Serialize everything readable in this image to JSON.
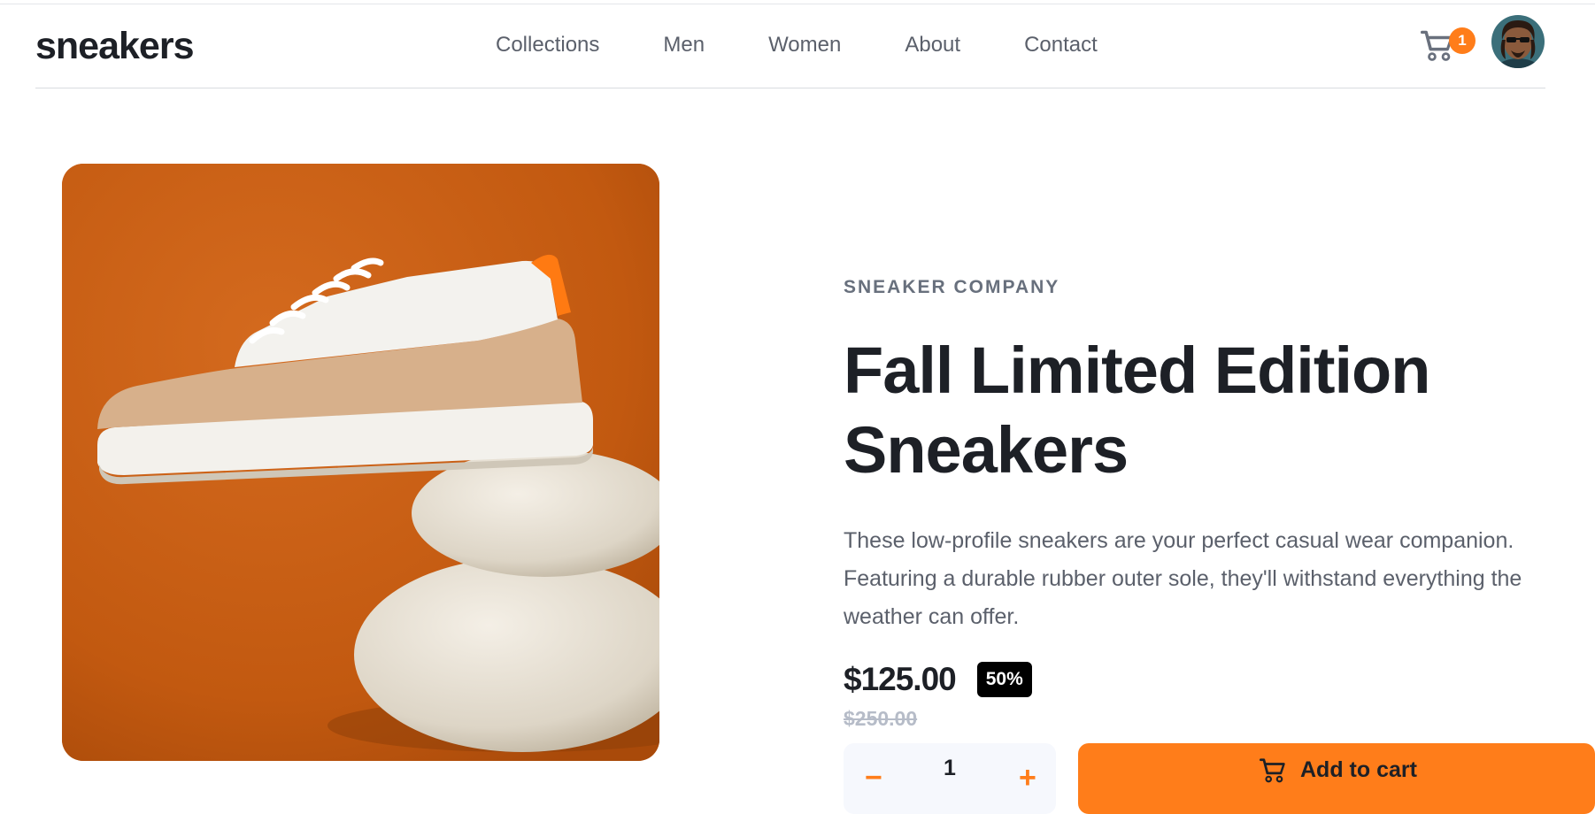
{
  "header": {
    "logo": "sneakers",
    "nav": [
      "Collections",
      "Men",
      "Women",
      "About",
      "Contact"
    ],
    "cart_count": "1"
  },
  "product": {
    "company": "SNEAKER COMPANY",
    "title": "Fall Limited Edition Sneakers",
    "description": "These low-profile sneakers are your perfect casual wear companion. Featuring a durable rubber outer sole, they'll withstand everything the weather can offer.",
    "price": "$125.00",
    "discount": "50%",
    "old_price": "$250.00",
    "quantity": "1",
    "add_to_cart_label": "Add to cart"
  },
  "colors": {
    "accent": "#ff7d1a",
    "text": "#1d2026",
    "muted": "#68707d",
    "image_bg": "#c75f12"
  }
}
